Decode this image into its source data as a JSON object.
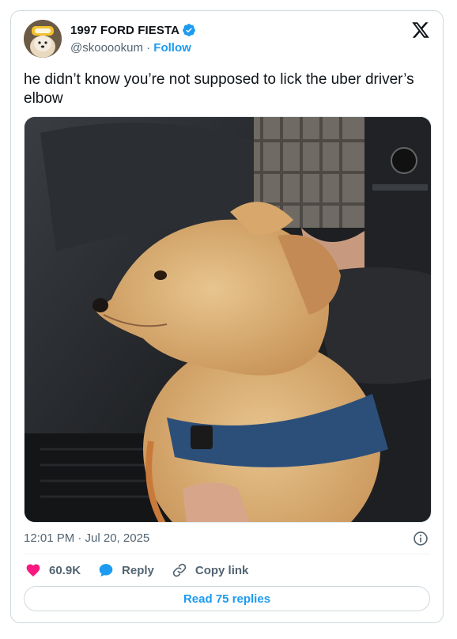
{
  "author": {
    "display_name": "1997 FORD FIESTA",
    "handle": "@skooookum",
    "separator": " · ",
    "follow_label": "Follow"
  },
  "tweet": {
    "text": "he didn’t know you’re not supposed to lick the uber driver’s elbow",
    "timestamp": "12:01 PM · Jul 20, 2025"
  },
  "actions": {
    "likes": "60.9K",
    "reply_label": "Reply",
    "copy_link_label": "Copy link"
  },
  "read_replies": "Read 75 replies",
  "colors": {
    "accent": "#1d9bf0",
    "like": "#f91880",
    "text": "#0f1419",
    "muted": "#536471",
    "border": "#cfd9de"
  },
  "icons": [
    "verified-badge-icon",
    "x-logo-icon",
    "info-icon",
    "heart-icon",
    "reply-bubble-icon",
    "link-icon"
  ]
}
